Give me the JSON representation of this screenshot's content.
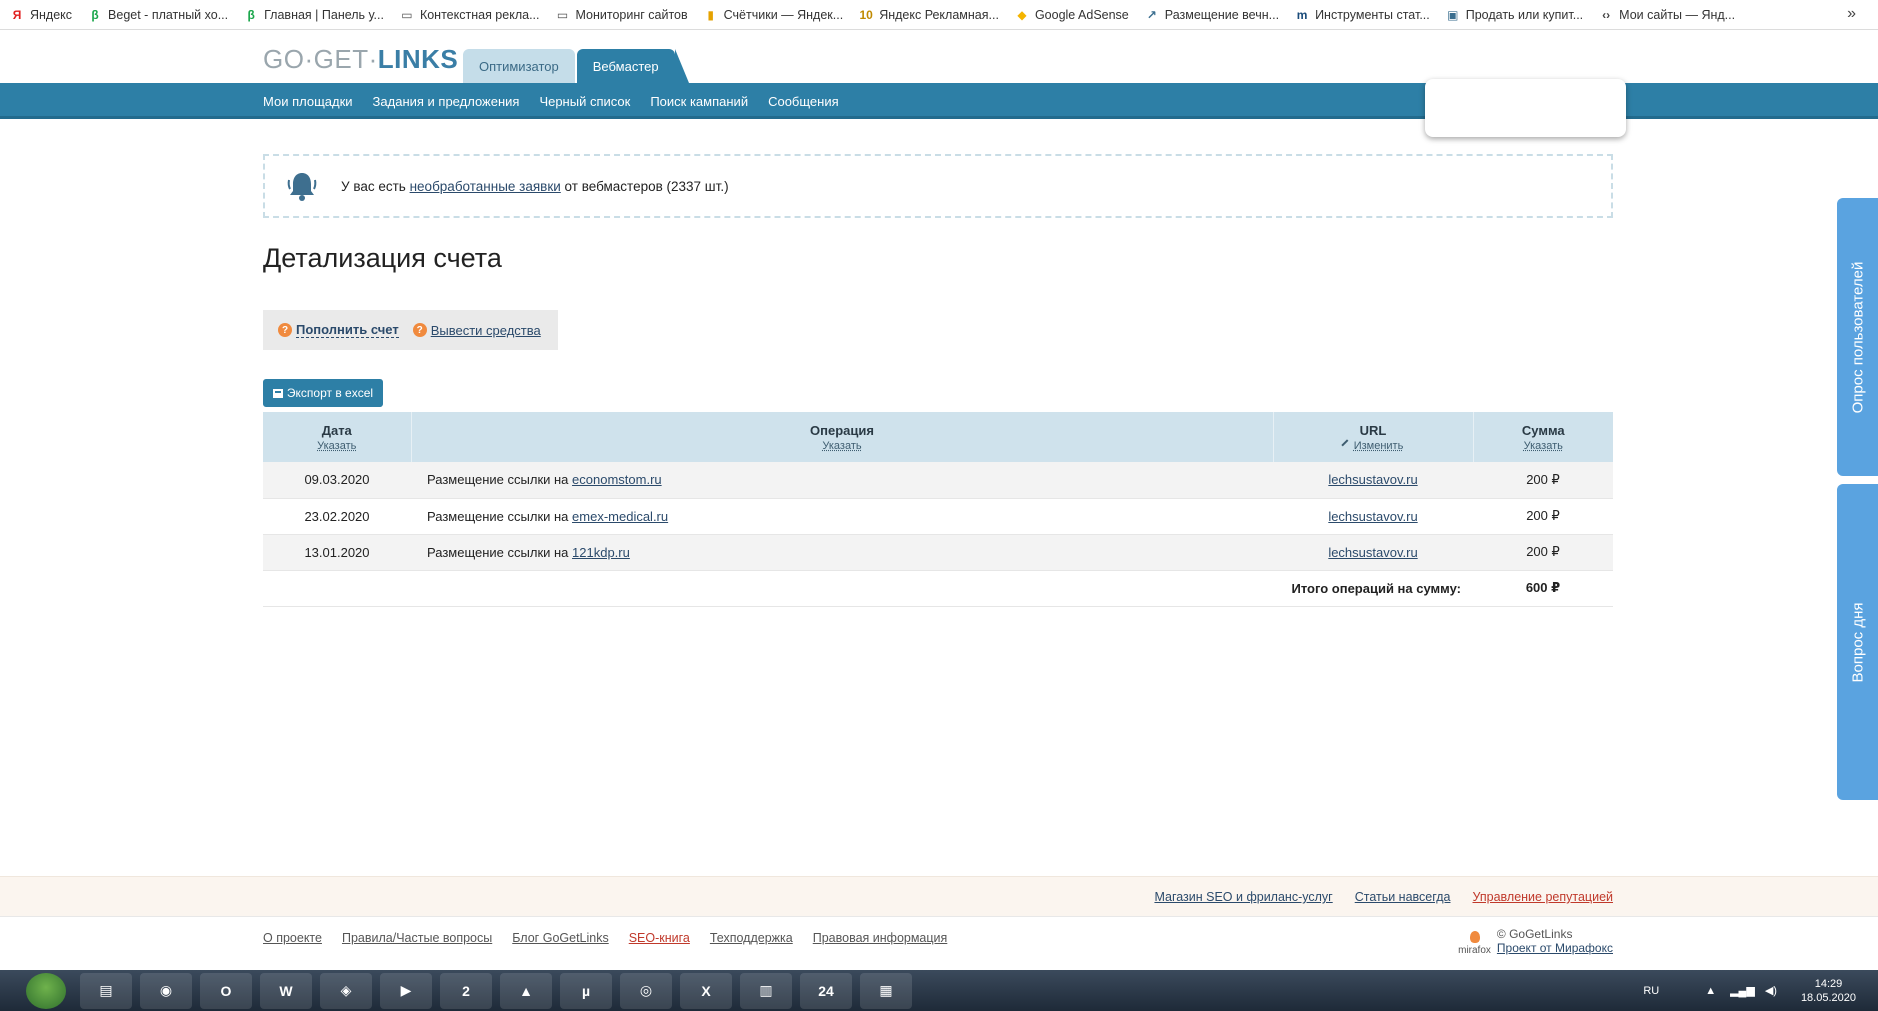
{
  "bookmarks": {
    "items": [
      {
        "label": "Яндекс",
        "icon": "yandex-icon",
        "glyph": "Я",
        "color": "#e02020"
      },
      {
        "label": "Beget - платный хо...",
        "icon": "beget-icon",
        "glyph": "β",
        "color": "#1aa64b"
      },
      {
        "label": "Главная | Панель у...",
        "icon": "beget-icon",
        "glyph": "β",
        "color": "#1aa64b"
      },
      {
        "label": "Контекстная рекла...",
        "icon": "folder-icon",
        "glyph": "▭",
        "color": "#555555"
      },
      {
        "label": "Мониторинг сайтов",
        "icon": "folder-icon",
        "glyph": "▭",
        "color": "#555555"
      },
      {
        "label": "Счётчики — Яндек...",
        "icon": "metrika-icon",
        "glyph": "▮",
        "color": "#e5a200"
      },
      {
        "label": "Яндекс Рекламная...",
        "icon": "yandex-direct-icon",
        "glyph": "10",
        "color": "#c08a00"
      },
      {
        "label": "Google AdSense",
        "icon": "adsense-icon",
        "glyph": "◆",
        "color": "#f4b400"
      },
      {
        "label": "Размещение вечн...",
        "icon": "chart-icon",
        "glyph": "↗",
        "color": "#3a6e8f"
      },
      {
        "label": "Инструменты стат...",
        "icon": "m-icon",
        "glyph": "m",
        "color": "#1a4b7a"
      },
      {
        "label": "Продать или купит...",
        "icon": "window-icon",
        "glyph": "▣",
        "color": "#3a6e8f"
      },
      {
        "label": "Мои сайты — Янд...",
        "icon": "code-icon",
        "glyph": "‹›",
        "color": "#444444"
      }
    ],
    "more": "»"
  },
  "header": {
    "logo_part1": "GO",
    "logo_part2": "GET",
    "logo_part3": "LINKS",
    "logo_sep": "·",
    "tab_optimizer": "Оптимизатор",
    "tab_webmaster": "Вебмастер"
  },
  "nav": {
    "items": [
      "Мои площадки",
      "Задания и предложения",
      "Черный список",
      "Поиск кампаний",
      "Сообщения"
    ]
  },
  "notice": {
    "prefix": "У вас есть ",
    "link": "необработанные заявки",
    "suffix": " от вебмастеров (2337 шт.)"
  },
  "page": {
    "title": "Детализация счета"
  },
  "actions": {
    "topup": "Пополнить счет",
    "withdraw": "Вывести средства",
    "help_glyph": "?"
  },
  "export": {
    "label": "Экспорт в excel"
  },
  "table": {
    "headers": {
      "date": "Дата",
      "date_sub": "Указать",
      "operation": "Операция",
      "operation_sub": "Указать",
      "url": "URL",
      "url_sub": "Изменить",
      "sum": "Сумма",
      "sum_sub": "Указать"
    },
    "rows": [
      {
        "date": "09.03.2020",
        "op_text": "Размещение ссылки на ",
        "op_link": "economstom.ru",
        "url": "lechsustavov.ru",
        "sum": "200 ₽"
      },
      {
        "date": "23.02.2020",
        "op_text": "Размещение ссылки на ",
        "op_link": "emex-medical.ru",
        "url": "lechsustavov.ru",
        "sum": "200 ₽"
      },
      {
        "date": "13.01.2020",
        "op_text": "Размещение ссылки на ",
        "op_link": "121kdp.ru",
        "url": "lechsustavov.ru",
        "sum": "200 ₽"
      }
    ],
    "total_label": "Итого операций на сумму:",
    "total_value": "600 ₽"
  },
  "sidetabs": {
    "survey": "Опрос пользователей",
    "question": "Вопрос дня"
  },
  "footer": {
    "top_links": [
      "Магазин SEO и фриланс-услуг",
      "Статьи навсегда",
      "Управление репутацией"
    ],
    "bottom_links": [
      "О проекте",
      "Правила/Частые вопросы",
      "Блог GoGetLinks",
      "SEO-книга",
      "Техподдержка",
      "Правовая информация"
    ],
    "copyright": "© GoGetLinks",
    "project": "Проект от Мирафокс",
    "mirafox": "mirafox"
  },
  "taskbar": {
    "apps": [
      {
        "icon": "explorer-icon",
        "glyph": "▤"
      },
      {
        "icon": "chrome-icon",
        "glyph": "◉"
      },
      {
        "icon": "opera-icon",
        "glyph": "O"
      },
      {
        "icon": "word-icon",
        "glyph": "W"
      },
      {
        "icon": "eye-app-icon",
        "glyph": "◈"
      },
      {
        "icon": "media-player-icon",
        "glyph": "▶"
      },
      {
        "icon": "calendar-app-icon",
        "glyph": "2"
      },
      {
        "icon": "vlc-icon",
        "glyph": "▲"
      },
      {
        "icon": "utorrent-icon",
        "glyph": "µ"
      },
      {
        "icon": "network-app-icon",
        "glyph": "◎"
      },
      {
        "icon": "excel-icon",
        "glyph": "X"
      },
      {
        "icon": "scanner-app-icon",
        "glyph": "▥"
      },
      {
        "icon": "app-24-icon",
        "glyph": "24"
      },
      {
        "icon": "calculator-icon",
        "glyph": "▦"
      }
    ],
    "lang": "RU",
    "time": "14:29",
    "date": "18.05.2020"
  }
}
